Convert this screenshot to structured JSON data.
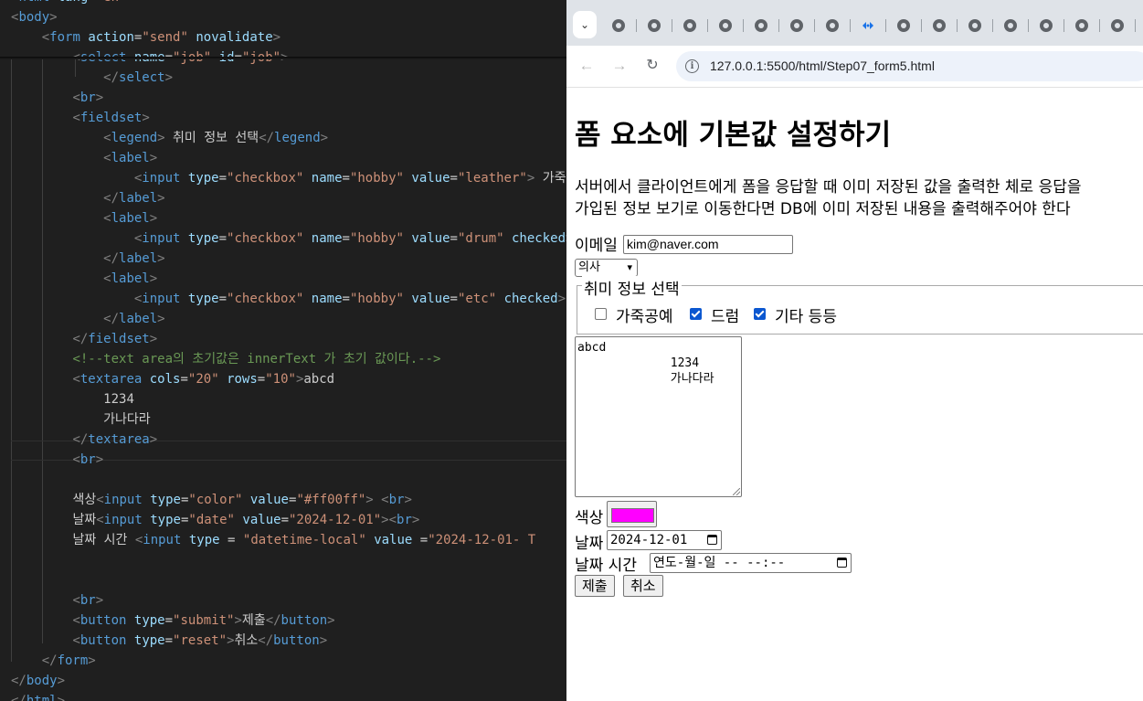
{
  "editor": {
    "lines": [
      {
        "html": "<span class=\"tk-p\">&lt;</span><span class=\"tk-t\">html</span> <span class=\"tk-a\">lang</span><span class=\"tk-x\">=</span><span class=\"tk-s\">\"en\"</span><span class=\"tk-p\">&gt;</span>"
      },
      {
        "html": "<span class=\"tk-p\">&lt;</span><span class=\"tk-t\">body</span><span class=\"tk-p\">&gt;</span>"
      },
      {
        "html": "    <span class=\"tk-p\">&lt;</span><span class=\"tk-t\">form</span> <span class=\"tk-a\">action</span><span class=\"tk-x\">=</span><span class=\"tk-s\">\"send\"</span> <span class=\"tk-a\">novalidate</span><span class=\"tk-p\">&gt;</span>"
      },
      {
        "html": "        <span class=\"tk-p\">&lt;</span><span class=\"tk-t\">select</span> <span class=\"tk-a\">name</span><span class=\"tk-x\">=</span><span class=\"tk-s\">\"job\"</span> <span class=\"tk-a\">id</span><span class=\"tk-x\">=</span><span class=\"tk-s\">\"job\"</span><span class=\"tk-p\">&gt;</span>"
      },
      {
        "html": "            <span class=\"tk-p\">&lt;/</span><span class=\"tk-t\">select</span><span class=\"tk-p\">&gt;</span>"
      },
      {
        "html": "        <span class=\"tk-p\">&lt;</span><span class=\"tk-t\">br</span><span class=\"tk-p\">&gt;</span>"
      },
      {
        "html": "        <span class=\"tk-p\">&lt;</span><span class=\"tk-t\">fieldset</span><span class=\"tk-p\">&gt;</span>"
      },
      {
        "html": "            <span class=\"tk-p\">&lt;</span><span class=\"tk-t\">legend</span><span class=\"tk-p\">&gt;</span><span class=\"tk-x\"> 취미 정보 선택</span><span class=\"tk-p\">&lt;/</span><span class=\"tk-t\">legend</span><span class=\"tk-p\">&gt;</span>"
      },
      {
        "html": "            <span class=\"tk-p\">&lt;</span><span class=\"tk-t\">label</span><span class=\"tk-p\">&gt;</span>"
      },
      {
        "html": "                <span class=\"tk-p\">&lt;</span><span class=\"tk-t\">input</span> <span class=\"tk-a\">type</span><span class=\"tk-x\">=</span><span class=\"tk-s\">\"checkbox\"</span> <span class=\"tk-a\">name</span><span class=\"tk-x\">=</span><span class=\"tk-s\">\"hobby\"</span> <span class=\"tk-a\">value</span><span class=\"tk-x\">=</span><span class=\"tk-s\">\"leather\"</span><span class=\"tk-p\">&gt;</span> <span class=\"tk-x\">가죽공예</span>"
      },
      {
        "html": "            <span class=\"tk-p\">&lt;/</span><span class=\"tk-t\">label</span><span class=\"tk-p\">&gt;</span>"
      },
      {
        "html": "            <span class=\"tk-p\">&lt;</span><span class=\"tk-t\">label</span><span class=\"tk-p\">&gt;</span>"
      },
      {
        "html": "                <span class=\"tk-p\">&lt;</span><span class=\"tk-t\">input</span> <span class=\"tk-a\">type</span><span class=\"tk-x\">=</span><span class=\"tk-s\">\"checkbox\"</span> <span class=\"tk-a\">name</span><span class=\"tk-x\">=</span><span class=\"tk-s\">\"hobby\"</span> <span class=\"tk-a\">value</span><span class=\"tk-x\">=</span><span class=\"tk-s\">\"drum\"</span> <span class=\"tk-a\">checked</span><span class=\"tk-p\">&gt;</span>"
      },
      {
        "html": "            <span class=\"tk-p\">&lt;/</span><span class=\"tk-t\">label</span><span class=\"tk-p\">&gt;</span>"
      },
      {
        "html": "            <span class=\"tk-p\">&lt;</span><span class=\"tk-t\">label</span><span class=\"tk-p\">&gt;</span>"
      },
      {
        "html": "                <span class=\"tk-p\">&lt;</span><span class=\"tk-t\">input</span> <span class=\"tk-a\">type</span><span class=\"tk-x\">=</span><span class=\"tk-s\">\"checkbox\"</span> <span class=\"tk-a\">name</span><span class=\"tk-x\">=</span><span class=\"tk-s\">\"hobby\"</span> <span class=\"tk-a\">value</span><span class=\"tk-x\">=</span><span class=\"tk-s\">\"etc\"</span> <span class=\"tk-a\">checked</span><span class=\"tk-p\">&gt;</span>"
      },
      {
        "html": "            <span class=\"tk-p\">&lt;/</span><span class=\"tk-t\">label</span><span class=\"tk-p\">&gt;</span>"
      },
      {
        "html": "        <span class=\"tk-p\">&lt;/</span><span class=\"tk-t\">fieldset</span><span class=\"tk-p\">&gt;</span>"
      },
      {
        "html": "        <span class=\"tk-c\">&lt;!--text area의 초기값은 innerText 가 초기 값이다.--&gt;</span>"
      },
      {
        "html": "        <span class=\"tk-p\">&lt;</span><span class=\"tk-t\">textarea</span> <span class=\"tk-a\">cols</span><span class=\"tk-x\">=</span><span class=\"tk-s\">\"20\"</span> <span class=\"tk-a\">rows</span><span class=\"tk-x\">=</span><span class=\"tk-s\">\"10\"</span><span class=\"tk-p\">&gt;</span><span class=\"tk-x\">abcd</span>"
      },
      {
        "html": "            <span class=\"tk-x\">1234</span>"
      },
      {
        "html": "            <span class=\"tk-x\">가나다라</span>"
      },
      {
        "html": "        <span class=\"tk-p\">&lt;/</span><span class=\"tk-t\">textarea</span><span class=\"tk-p\">&gt;</span>"
      },
      {
        "html": "        <span class=\"tk-p\">&lt;</span><span class=\"tk-t\">br</span><span class=\"tk-p\">&gt;</span>"
      },
      {
        "html": ""
      },
      {
        "html": "        <span class=\"tk-x\">색상</span><span class=\"tk-p\">&lt;</span><span class=\"tk-t\">input</span> <span class=\"tk-a\">type</span><span class=\"tk-x\">=</span><span class=\"tk-s\">\"color\"</span> <span class=\"tk-a\">value</span><span class=\"tk-x\">=</span><span class=\"tk-s\">\"#ff00ff\"</span><span class=\"tk-p\">&gt;</span> <span class=\"tk-p\">&lt;</span><span class=\"tk-t\">br</span><span class=\"tk-p\">&gt;</span>"
      },
      {
        "html": "        <span class=\"tk-x\">날짜</span><span class=\"tk-p\">&lt;</span><span class=\"tk-t\">input</span> <span class=\"tk-a\">type</span><span class=\"tk-x\">=</span><span class=\"tk-s\">\"date\"</span> <span class=\"tk-a\">value</span><span class=\"tk-x\">=</span><span class=\"tk-s\">\"2024-12-01\"</span><span class=\"tk-p\">&gt;&lt;</span><span class=\"tk-t\">br</span><span class=\"tk-p\">&gt;</span>"
      },
      {
        "html": "        <span class=\"tk-x\">날짜 시간 </span><span class=\"tk-p\">&lt;</span><span class=\"tk-t\">input</span> <span class=\"tk-a\">type</span> <span class=\"tk-x\">=</span> <span class=\"tk-s\">\"datetime-local\"</span> <span class=\"tk-a\">value</span> <span class=\"tk-x\">=</span><span class=\"tk-s\">\"2024-12-01- T</span>"
      },
      {
        "html": ""
      },
      {
        "html": ""
      },
      {
        "html": "        <span class=\"tk-p\">&lt;</span><span class=\"tk-t\">br</span><span class=\"tk-p\">&gt;</span>"
      },
      {
        "html": "        <span class=\"tk-p\">&lt;</span><span class=\"tk-t\">button</span> <span class=\"tk-a\">type</span><span class=\"tk-x\">=</span><span class=\"tk-s\">\"submit\"</span><span class=\"tk-p\">&gt;</span><span class=\"tk-x\">제출</span><span class=\"tk-p\">&lt;/</span><span class=\"tk-t\">button</span><span class=\"tk-p\">&gt;</span>"
      },
      {
        "html": "        <span class=\"tk-p\">&lt;</span><span class=\"tk-t\">button</span> <span class=\"tk-a\">type</span><span class=\"tk-x\">=</span><span class=\"tk-s\">\"reset\"</span><span class=\"tk-p\">&gt;</span><span class=\"tk-x\">취소</span><span class=\"tk-p\">&lt;/</span><span class=\"tk-t\">button</span><span class=\"tk-p\">&gt;</span>"
      },
      {
        "html": "    <span class=\"tk-p\">&lt;/</span><span class=\"tk-t\">form</span><span class=\"tk-p\">&gt;</span>"
      },
      {
        "html": "<span class=\"tk-p\">&lt;/</span><span class=\"tk-t\">body</span><span class=\"tk-p\">&gt;</span>"
      },
      {
        "html": "<span class=\"tk-p\">&lt;/</span><span class=\"tk-t\">html</span><span class=\"tk-p\">&gt;</span>"
      }
    ],
    "colors": {
      "background": "#1f1f1f",
      "tag": "#569cd6",
      "attribute": "#9cdcfe",
      "string": "#ce9178",
      "comment": "#6a9955",
      "punctuation": "#808080",
      "text": "#cccccc"
    }
  },
  "browser": {
    "tab_count": 15,
    "active_tab_icon": "vscode-live-server-icon",
    "url": "127.0.0.1:5500/html/Step07_form5.html",
    "icons": {
      "back": "back-arrow-icon",
      "forward": "forward-arrow-icon",
      "reload": "reload-icon",
      "site_info": "site-info-icon",
      "tab_search": "chevron-down-icon"
    }
  },
  "page": {
    "title": "폼 요소에 기본값 설정하기",
    "paragraph_line1": "서버에서 클라이언트에게 폼을 응답할 때 이미 저장된 값을 출력한 체로 응답을",
    "paragraph_line2": "가입된 정보 보기로 이동한다면 DB에 이미 저장된 내용을 출력해주어야 한다",
    "email_label": "이메일",
    "email_value": "kim@naver.com",
    "job_selected": "의사",
    "legend": "취미 정보 선택",
    "hobbies": [
      {
        "label": "가죽공예",
        "checked": false
      },
      {
        "label": "드럼",
        "checked": true
      },
      {
        "label": "기타 등등",
        "checked": true
      }
    ],
    "textarea_value": "abcd\n             1234\n             가나다라",
    "color_label": "색상",
    "color_value": "#ff00ff",
    "date_label": "날짜",
    "date_value": "2024-12-01",
    "datetime_label": "날짜 시간",
    "datetime_placeholder": "연도-월-일 -- --:--",
    "submit_label": "제출",
    "reset_label": "취소"
  }
}
